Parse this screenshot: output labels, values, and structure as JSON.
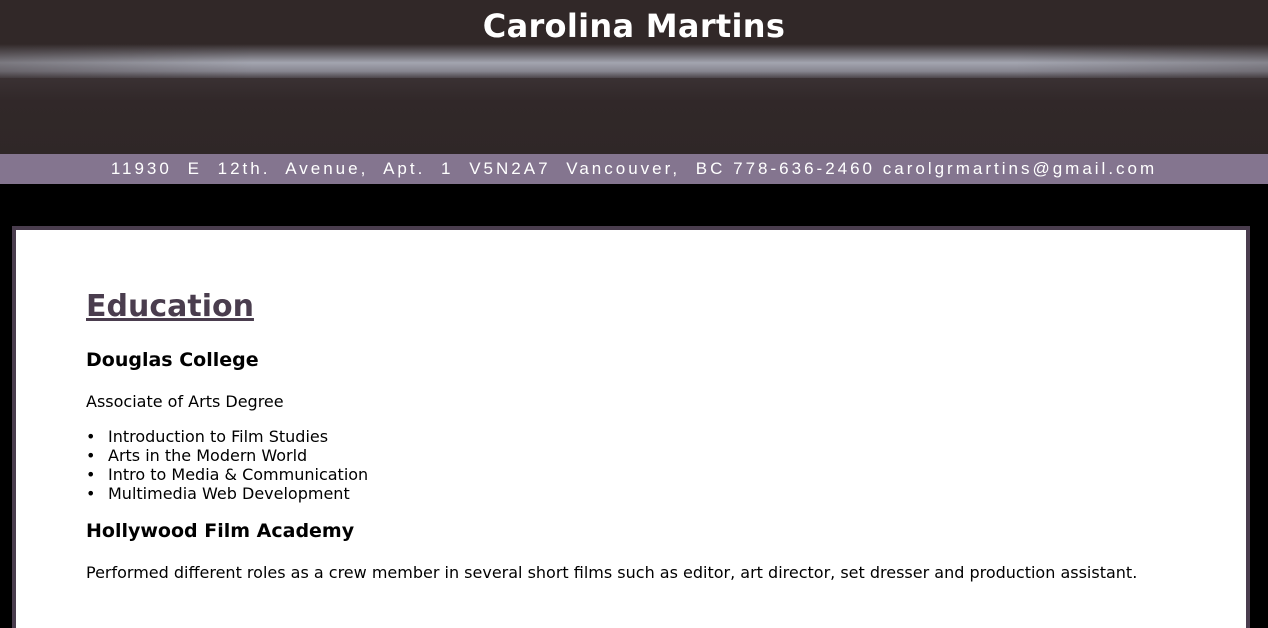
{
  "header": {
    "name": "Carolina Martins"
  },
  "contact": {
    "address": "11930 E 12th. Avenue, Apt. 1 V5N2A7 Vancouver, BC",
    "phone": "778-636-2460",
    "email": "carolgrmartins@gmail.com"
  },
  "education": {
    "title": "Education",
    "schools": [
      {
        "name": "Douglas College",
        "description": "Associate of Arts Degree",
        "courses": [
          "Introduction to Film Studies",
          "Arts in the Modern World",
          "Intro to Media & Communication",
          "Multimedia Web Development"
        ]
      },
      {
        "name": "Hollywood Film Academy",
        "description": "Performed different roles as a crew member in several short films such as editor, art director, set dresser and production assistant."
      }
    ]
  },
  "colors": {
    "header_bg": "#312828",
    "contact_bar_bg": "#84758f",
    "accent": "#4a3d4e",
    "page_bg": "#000000",
    "card_bg": "#ffffff"
  }
}
